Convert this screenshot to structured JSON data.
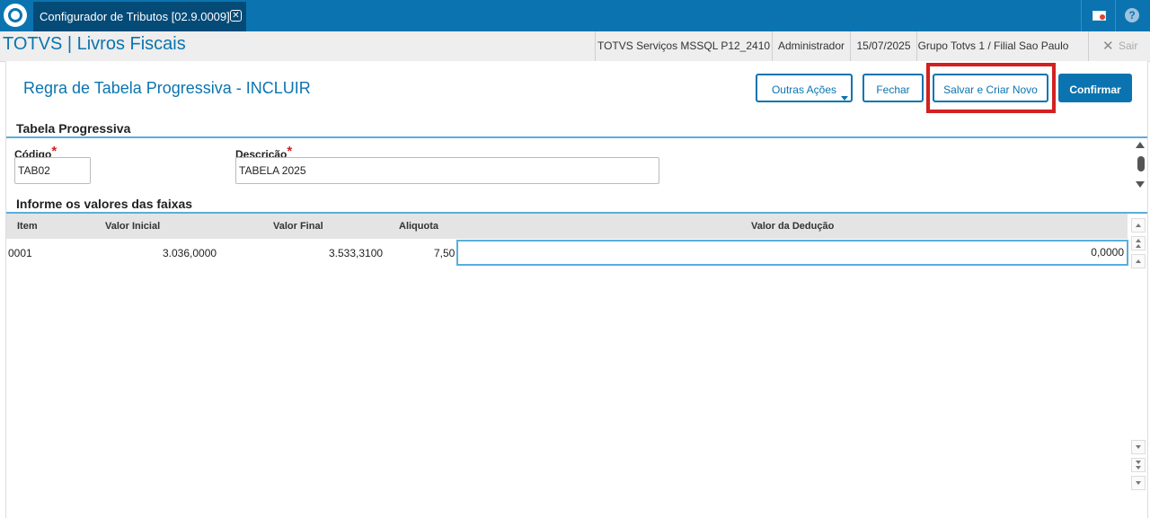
{
  "topbar": {
    "tab_title": "Configurador de Tributos [02.9.0009]",
    "tab_close": "✕",
    "icons": [
      "totvs-logo-icon",
      "mail-icon",
      "help-icon"
    ],
    "help_glyph": "?"
  },
  "header": {
    "app_title": "TOTVS | Livros Fiscais",
    "environment": "TOTVS Serviços MSSQL P12_2410",
    "user": "Administrador",
    "date": "15/07/2025",
    "branch": "Grupo Totvs 1 / Filial Sao Paulo",
    "exit_label": "Sair",
    "exit_glyph": "✕"
  },
  "page": {
    "title": "Regra de Tabela Progressiva - INCLUIR"
  },
  "actions": {
    "more_label": "Outras Ações",
    "close_label": "Fechar",
    "save_new_label": "Salvar e Criar Novo",
    "confirm_label": "Confirmar"
  },
  "form": {
    "section_title": "Tabela Progressiva",
    "code_label": "Código",
    "code_value": "TAB02",
    "description_label": "Descrição",
    "description_value": "TABELA 2025",
    "required_mark": "*"
  },
  "grid": {
    "section_title": "Informe os valores das faixas",
    "columns": [
      "Item",
      "Valor Inicial",
      "Valor Final",
      "Aliquota",
      "Valor da Dedução"
    ],
    "rows": [
      {
        "item": "0001",
        "valor_inicial": "3.036,0000",
        "valor_final": "3.533,3100",
        "aliquota": "7,50",
        "valor_deducao": "0,0000"
      }
    ]
  },
  "colors": {
    "brand_blue": "#0b74b0",
    "highlight_red": "#d32020",
    "accent_line": "#5aaedc"
  }
}
